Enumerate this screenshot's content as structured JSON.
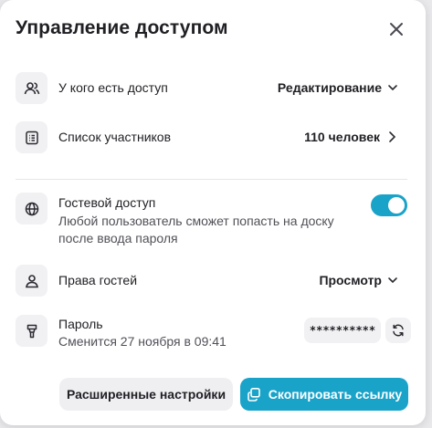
{
  "dialog": {
    "title": "Управление доступом",
    "close_icon": "close-icon"
  },
  "access": {
    "label": "У кого есть доступ",
    "value": "Редактирование",
    "icon": "users-icon"
  },
  "members": {
    "label": "Список участников",
    "value": "110 человек",
    "icon": "list-icon"
  },
  "guest_access": {
    "label": "Гостевой доступ",
    "description_line1": "Любой пользователь сможет попасть на доску",
    "description_line2": "после ввода пароля",
    "enabled": true,
    "icon": "globe-icon"
  },
  "guest_rights": {
    "label": "Права гостей",
    "value": "Просмотр",
    "icon": "user-icon"
  },
  "password": {
    "label": "Пароль",
    "sub": "Сменится 27 ноября в 09:41",
    "value": "**********",
    "icon": "key-icon"
  },
  "buttons": {
    "advanced": "Расширенные настройки",
    "copy_link": "Скопировать ссылку"
  },
  "colors": {
    "accent": "#1aa3c9",
    "icon_bg": "#f1f1f4"
  }
}
